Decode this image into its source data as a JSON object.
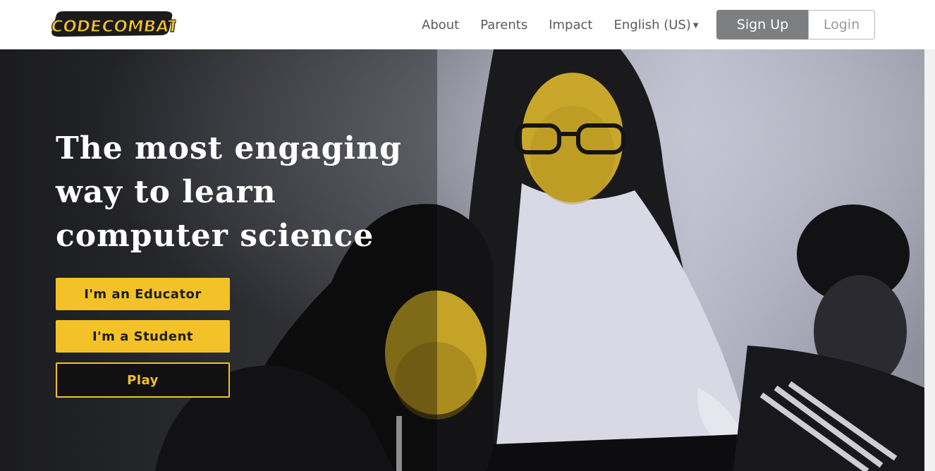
{
  "header": {
    "logo_text": "CODE COMBAT",
    "nav": [
      {
        "label": "About"
      },
      {
        "label": "Parents"
      },
      {
        "label": "Impact"
      }
    ],
    "language": {
      "label": "English (US)",
      "icon": "caret-down-icon"
    },
    "signup_label": "Sign Up",
    "login_label": "Login"
  },
  "hero": {
    "headline_lines": [
      "The most engaging",
      "way to learn",
      "computer science"
    ],
    "buttons": {
      "educator": "I'm an Educator",
      "student": "I'm a Student",
      "play": "Play"
    }
  },
  "colors": {
    "accent": "#f3c228",
    "signup_bg": "#7d7e80",
    "nav_text": "#5b5b5b"
  }
}
